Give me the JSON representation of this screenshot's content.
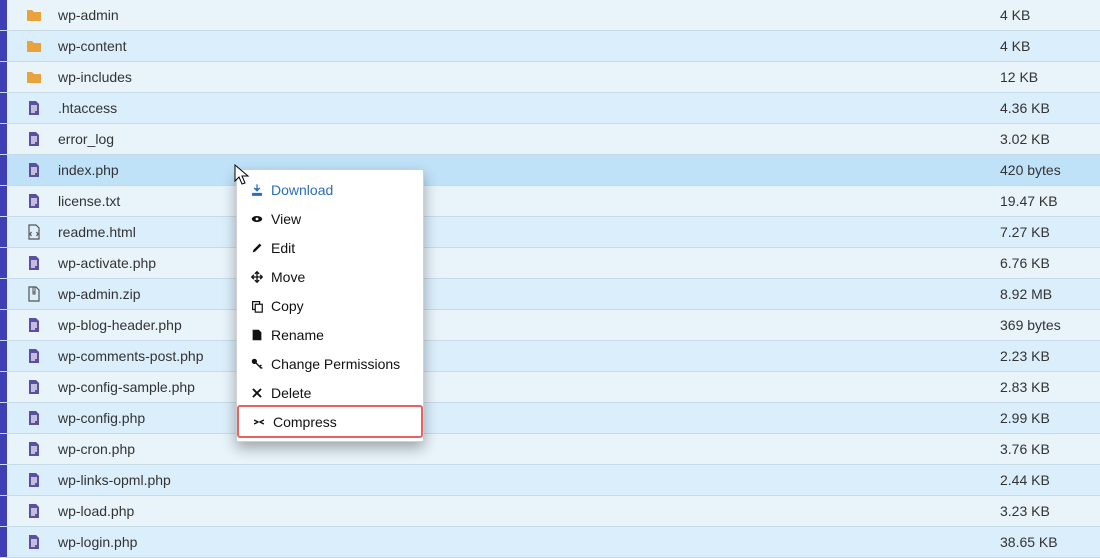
{
  "files": [
    {
      "name": "wp-admin",
      "size": "4 KB",
      "icon": "folder",
      "selected": false
    },
    {
      "name": "wp-content",
      "size": "4 KB",
      "icon": "folder",
      "selected": false
    },
    {
      "name": "wp-includes",
      "size": "12 KB",
      "icon": "folder",
      "selected": false
    },
    {
      "name": ".htaccess",
      "size": "4.36 KB",
      "icon": "doc",
      "selected": false
    },
    {
      "name": "error_log",
      "size": "3.02 KB",
      "icon": "doc",
      "selected": false
    },
    {
      "name": "index.php",
      "size": "420 bytes",
      "icon": "doc",
      "selected": true
    },
    {
      "name": "license.txt",
      "size": "19.47 KB",
      "icon": "doc",
      "selected": false
    },
    {
      "name": "readme.html",
      "size": "7.27 KB",
      "icon": "html",
      "selected": false
    },
    {
      "name": "wp-activate.php",
      "size": "6.76 KB",
      "icon": "doc",
      "selected": false
    },
    {
      "name": "wp-admin.zip",
      "size": "8.92 MB",
      "icon": "zip",
      "selected": false
    },
    {
      "name": "wp-blog-header.php",
      "size": "369 bytes",
      "icon": "doc",
      "selected": false
    },
    {
      "name": "wp-comments-post.php",
      "size": "2.23 KB",
      "icon": "doc",
      "selected": false
    },
    {
      "name": "wp-config-sample.php",
      "size": "2.83 KB",
      "icon": "doc",
      "selected": false
    },
    {
      "name": "wp-config.php",
      "size": "2.99 KB",
      "icon": "doc",
      "selected": false
    },
    {
      "name": "wp-cron.php",
      "size": "3.76 KB",
      "icon": "doc",
      "selected": false
    },
    {
      "name": "wp-links-opml.php",
      "size": "2.44 KB",
      "icon": "doc",
      "selected": false
    },
    {
      "name": "wp-load.php",
      "size": "3.23 KB",
      "icon": "doc",
      "selected": false
    },
    {
      "name": "wp-login.php",
      "size": "38.65 KB",
      "icon": "doc",
      "selected": false
    }
  ],
  "menu": {
    "items": [
      {
        "icon": "download-icon",
        "label": "Download",
        "active": true,
        "highlighted": false
      },
      {
        "icon": "eye-icon",
        "label": "View",
        "active": false,
        "highlighted": false
      },
      {
        "icon": "pencil-icon",
        "label": "Edit",
        "active": false,
        "highlighted": false
      },
      {
        "icon": "move-icon",
        "label": "Move",
        "active": false,
        "highlighted": false
      },
      {
        "icon": "copy-icon",
        "label": "Copy",
        "active": false,
        "highlighted": false
      },
      {
        "icon": "rename-icon",
        "label": "Rename",
        "active": false,
        "highlighted": false
      },
      {
        "icon": "key-icon",
        "label": "Change Permissions",
        "active": false,
        "highlighted": false
      },
      {
        "icon": "delete-icon",
        "label": "Delete",
        "active": false,
        "highlighted": false
      },
      {
        "icon": "compress-icon",
        "label": "Compress",
        "active": false,
        "highlighted": true
      }
    ]
  }
}
